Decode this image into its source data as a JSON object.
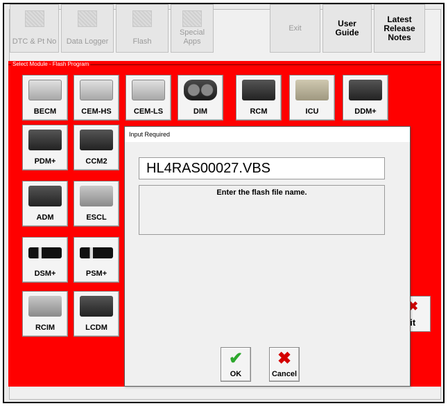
{
  "toolbar": {
    "buttons": [
      {
        "label": "DTC & Pt No"
      },
      {
        "label": "Data Logger"
      },
      {
        "label": "Flash"
      },
      {
        "label": "Special Apps"
      },
      {
        "label": "Exit"
      },
      {
        "label": "User Guide"
      },
      {
        "label": "Latest Release Notes"
      }
    ]
  },
  "panel": {
    "legend": "Select Module - Flash Program",
    "modules": [
      {
        "label": "BECM"
      },
      {
        "label": "CEM-HS"
      },
      {
        "label": "CEM-LS"
      },
      {
        "label": "DIM"
      },
      {
        "label": "RCM"
      },
      {
        "label": "ICU"
      },
      {
        "label": "DDM+"
      },
      {
        "label": "PDM+"
      },
      {
        "label": "CCM2"
      },
      {
        "label": "ADM"
      },
      {
        "label": "ESCL"
      },
      {
        "label": "DSM+"
      },
      {
        "label": "PSM+"
      },
      {
        "label": "RCIM"
      },
      {
        "label": "LCDM"
      }
    ],
    "exit_fragment": "xit"
  },
  "dialog": {
    "title": "Input Required",
    "input_value": "HL4RAS00027.VBS",
    "prompt": "Enter the flash file name.",
    "ok_label": "OK",
    "cancel_label": "Cancel"
  }
}
